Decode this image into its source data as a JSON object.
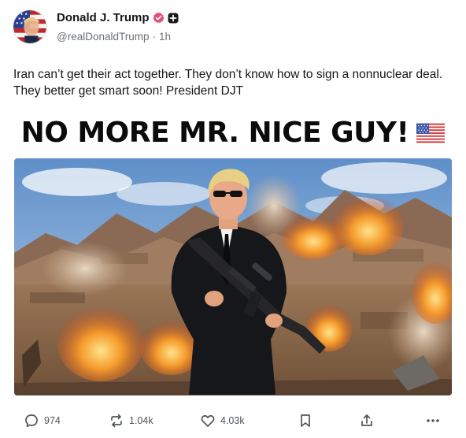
{
  "author": {
    "display_name": "Donald J. Trump",
    "handle": "@realDonaldTrump",
    "separator": "·",
    "time": "1h"
  },
  "post": {
    "text": "Iran can’t get their act together. They don’t know how to sign a nonnuclear deal. They better get smart soon! President DJT"
  },
  "media": {
    "headline": "NO MORE MR. NICE GUY!",
    "flag_icon": "us-flag-icon"
  },
  "actions": {
    "replies": "974",
    "reposts": "1.04k",
    "likes": "4.03k"
  },
  "colors": {
    "verified": "#e0507a",
    "text": "#14171a",
    "muted": "#6b7178"
  }
}
